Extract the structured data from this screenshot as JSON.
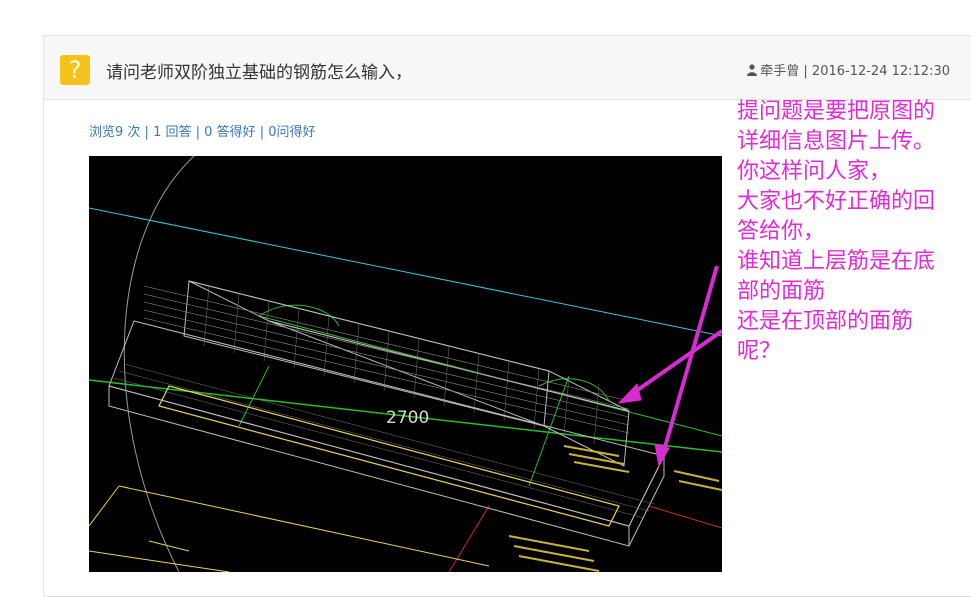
{
  "question": {
    "icon": "question-mark-icon",
    "icon_glyph": "?",
    "title": "请问老师双阶独立基础的钢筋怎么输入，",
    "author": "牵手曾",
    "separator": "|",
    "datetime": "2016-12-24 12:12:30",
    "stats": {
      "views": "浏览9 次",
      "answers": "1 回答",
      "good_answers": "0 答得好",
      "good_questions": "0问得好"
    }
  },
  "image": {
    "dimension_label": "2700"
  },
  "annotation": {
    "color": "#e22bd5",
    "lines": [
      "提问题是要把原图的",
      "详细信息图片上传。",
      "你这样问人家，",
      "大家也不好正确的回",
      "答给你，",
      "谁知道上层筋是在底",
      "部的面筋",
      "还是在顶部的面筋",
      "呢？"
    ]
  },
  "colors": {
    "accent_icon": "#f6c21a",
    "link": "#3a77b8"
  }
}
